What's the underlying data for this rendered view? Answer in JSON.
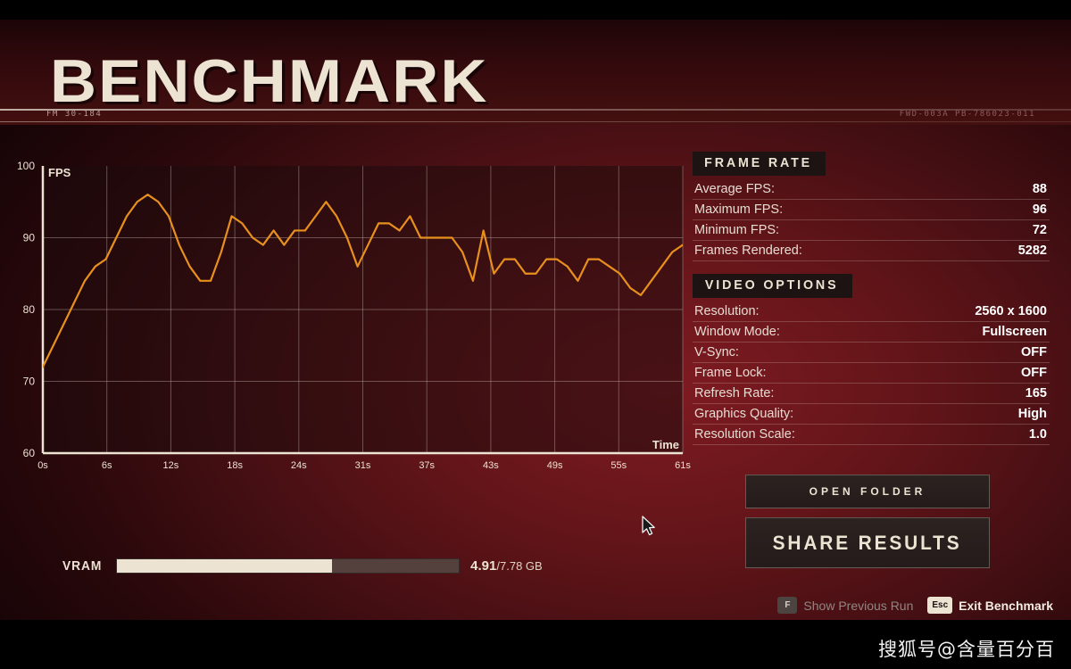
{
  "header": {
    "title": "BENCHMARK",
    "code_left": "FM 30-184",
    "code_right": "FWD-003A PB-786023-011"
  },
  "chart_labels": {
    "y_axis_label": "FPS",
    "x_axis_label": "Time"
  },
  "chart_data": {
    "type": "line",
    "title": "",
    "xlabel": "Time",
    "ylabel": "FPS",
    "ylim": [
      60,
      100
    ],
    "yticks": [
      60,
      70,
      80,
      90,
      100
    ],
    "xticks": [
      "0s",
      "6s",
      "12s",
      "18s",
      "24s",
      "31s",
      "37s",
      "43s",
      "49s",
      "55s",
      "61s"
    ],
    "xlim": [
      0,
      61
    ],
    "grid": true,
    "line_color": "#e8901e",
    "series": [
      {
        "name": "FPS",
        "x": [
          0,
          1,
          2,
          3,
          4,
          5,
          6,
          7,
          8,
          9,
          10,
          11,
          12,
          13,
          14,
          15,
          16,
          17,
          18,
          19,
          20,
          21,
          22,
          23,
          24,
          25,
          26,
          27,
          28,
          29,
          30,
          31,
          32,
          33,
          34,
          35,
          36,
          37,
          38,
          39,
          40,
          41,
          42,
          43,
          44,
          45,
          46,
          47,
          48,
          49,
          50,
          51,
          52,
          53,
          54,
          55,
          56,
          57,
          58,
          59,
          60,
          61
        ],
        "values": [
          72,
          75,
          78,
          81,
          84,
          86,
          87,
          90,
          93,
          95,
          96,
          95,
          93,
          89,
          86,
          84,
          84,
          88,
          93,
          92,
          90,
          89,
          91,
          89,
          91,
          91,
          93,
          95,
          93,
          90,
          86,
          89,
          92,
          92,
          91,
          93,
          90,
          90,
          90,
          90,
          88,
          84,
          91,
          85,
          87,
          87,
          85,
          85,
          87,
          87,
          86,
          84,
          87,
          87,
          86,
          85,
          83,
          82,
          84,
          86,
          88,
          89
        ]
      }
    ]
  },
  "vram": {
    "label": "VRAM",
    "used": "4.91",
    "separator": "/",
    "total": "7.78 GB",
    "percent": 63
  },
  "frame_rate": {
    "heading": "FRAME RATE",
    "rows": [
      {
        "key": "Average FPS:",
        "value": "88"
      },
      {
        "key": "Maximum FPS:",
        "value": "96"
      },
      {
        "key": "Minimum FPS:",
        "value": "72"
      },
      {
        "key": "Frames Rendered:",
        "value": "5282"
      }
    ]
  },
  "video_options": {
    "heading": "VIDEO OPTIONS",
    "rows": [
      {
        "key": "Resolution:",
        "value": "2560 x 1600"
      },
      {
        "key": "Window Mode:",
        "value": "Fullscreen"
      },
      {
        "key": "V-Sync:",
        "value": "OFF"
      },
      {
        "key": "Frame Lock:",
        "value": "OFF"
      },
      {
        "key": "Refresh Rate:",
        "value": "165"
      },
      {
        "key": "Graphics Quality:",
        "value": "High"
      },
      {
        "key": "Resolution Scale:",
        "value": "1.0"
      }
    ]
  },
  "buttons": {
    "open_folder": "OPEN FOLDER",
    "share_results": "SHARE RESULTS"
  },
  "prompts": [
    {
      "key": "F",
      "label": "Show Previous Run",
      "state": "dim"
    },
    {
      "key": "Esc",
      "label": "Exit Benchmark",
      "state": "lit"
    }
  ],
  "watermark": "搜狐号@含量百分百"
}
